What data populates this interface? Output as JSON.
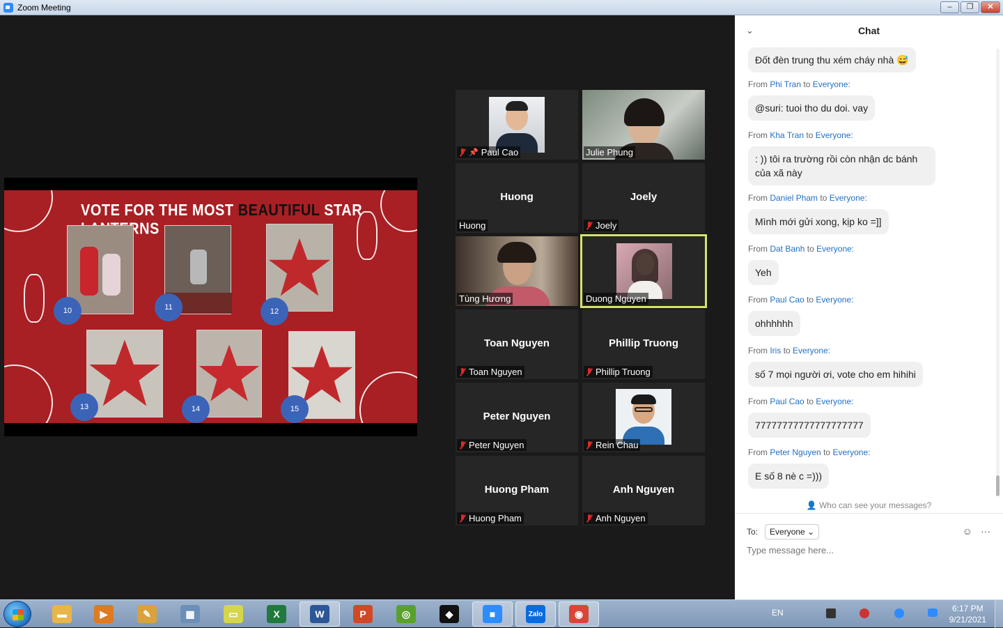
{
  "window": {
    "title": "Zoom Meeting",
    "minimize": "–",
    "maximize": "❐",
    "close": "✕"
  },
  "slide": {
    "title_part1": "VOTE FOR THE MOST ",
    "title_part2": "BEAUTIFUL",
    "title_part3": " STAR LANTERNS",
    "badges": [
      "10",
      "11",
      "12",
      "13",
      "14",
      "15"
    ]
  },
  "gallery": [
    {
      "name": "Paul Cao",
      "label": "Paul Cao",
      "muted": true,
      "pinned": true,
      "video": "avatar"
    },
    {
      "name": "Julie Phung",
      "label": "Julie Phung",
      "muted": false,
      "video": "camera"
    },
    {
      "name": "Huong",
      "label": "Huong",
      "muted": false,
      "video": "none"
    },
    {
      "name": "Joely",
      "label": "Joely",
      "muted": true,
      "video": "none"
    },
    {
      "name": "Tùng Hương",
      "label": "Tùng Hương",
      "muted": false,
      "video": "camera"
    },
    {
      "name": "Duong Nguyen",
      "label": "Duong Nguyen",
      "muted": false,
      "video": "avatar",
      "speaking": true
    },
    {
      "name": "Toan Nguyen",
      "label": "Toan Nguyen",
      "muted": true,
      "video": "none"
    },
    {
      "name": "Phillip Truong",
      "label": "Phillip Truong",
      "muted": true,
      "video": "none"
    },
    {
      "name": "Peter Nguyen",
      "label": "Peter Nguyen",
      "muted": true,
      "video": "none"
    },
    {
      "name": "Rein Chau",
      "label": "Rein Chau",
      "muted": true,
      "video": "avatar"
    },
    {
      "name": "Huong Pham",
      "label": "Huong Pham",
      "muted": true,
      "video": "none"
    },
    {
      "name": "Anh Nguyen",
      "label": "Anh Nguyen",
      "muted": true,
      "video": "none"
    }
  ],
  "chat": {
    "title": "Chat",
    "collapse_icon": "⌄",
    "first_bubble": "Đốt đèn trung thu xém cháy nhà 😅",
    "from_word": "From",
    "to_word": "to",
    "messages": [
      {
        "sender": "Phi Tran",
        "recipient": "Everyone:",
        "text": "@suri: tuoi tho du doi. vay"
      },
      {
        "sender": "Kha Tran",
        "recipient": "Everyone:",
        "text": ": )) tôi ra trường rồi còn nhận dc bánh của xã này"
      },
      {
        "sender": "Daniel Pham",
        "recipient": "Everyone:",
        "text": "Mình mới gửi xong, kịp ko =]]"
      },
      {
        "sender": "Dat Banh",
        "recipient": "Everyone:",
        "text": "Yeh"
      },
      {
        "sender": "Paul Cao",
        "recipient": "Everyone:",
        "text": "ohhhhhh"
      },
      {
        "sender": "Iris",
        "recipient": "Everyone:",
        "text": "số 7 mọi người ơi, vote cho em hihihi"
      },
      {
        "sender": "Paul Cao",
        "recipient": "Everyone:",
        "text": "77777777777777777777"
      },
      {
        "sender": "Peter Nguyen",
        "recipient": "Everyone:",
        "text": "E số 8 nè c =)))"
      }
    ],
    "who_can_see": "Who can see your messages?",
    "to_label": "To:",
    "to_value": "Everyone",
    "placeholder": "Type message here...",
    "emoji_icon": "☺",
    "more_icon": "···"
  },
  "taskbar": {
    "apps": [
      {
        "icon": "folder-icon",
        "color": "#e8b548",
        "glyph": "▬"
      },
      {
        "icon": "media-player-icon",
        "color": "#e07a1e",
        "glyph": "▶"
      },
      {
        "icon": "paint-icon",
        "color": "#d9a23c",
        "glyph": "✎"
      },
      {
        "icon": "calculator-icon",
        "color": "#6c8fb8",
        "glyph": "▦"
      },
      {
        "icon": "sticky-notes-icon",
        "color": "#d6d64a",
        "glyph": "▭"
      },
      {
        "icon": "excel-icon",
        "color": "#1f7a3c",
        "glyph": "X"
      },
      {
        "icon": "word-icon",
        "color": "#2b5797",
        "glyph": "W"
      },
      {
        "icon": "powerpoint-icon",
        "color": "#d24726",
        "glyph": "P"
      },
      {
        "icon": "app-green-icon",
        "color": "#5aa02c",
        "glyph": "◎"
      },
      {
        "icon": "garena-icon",
        "color": "#111111",
        "glyph": "◆"
      },
      {
        "icon": "zoom-icon",
        "color": "#2d8cff",
        "glyph": "■"
      },
      {
        "icon": "zalo-icon",
        "color": "#0a6be0",
        "glyph": "Zalo"
      },
      {
        "icon": "chrome-icon",
        "color": "#db4437",
        "glyph": "◉"
      }
    ],
    "language": "EN",
    "time": "6:17 PM",
    "date": "9/21/2021"
  }
}
